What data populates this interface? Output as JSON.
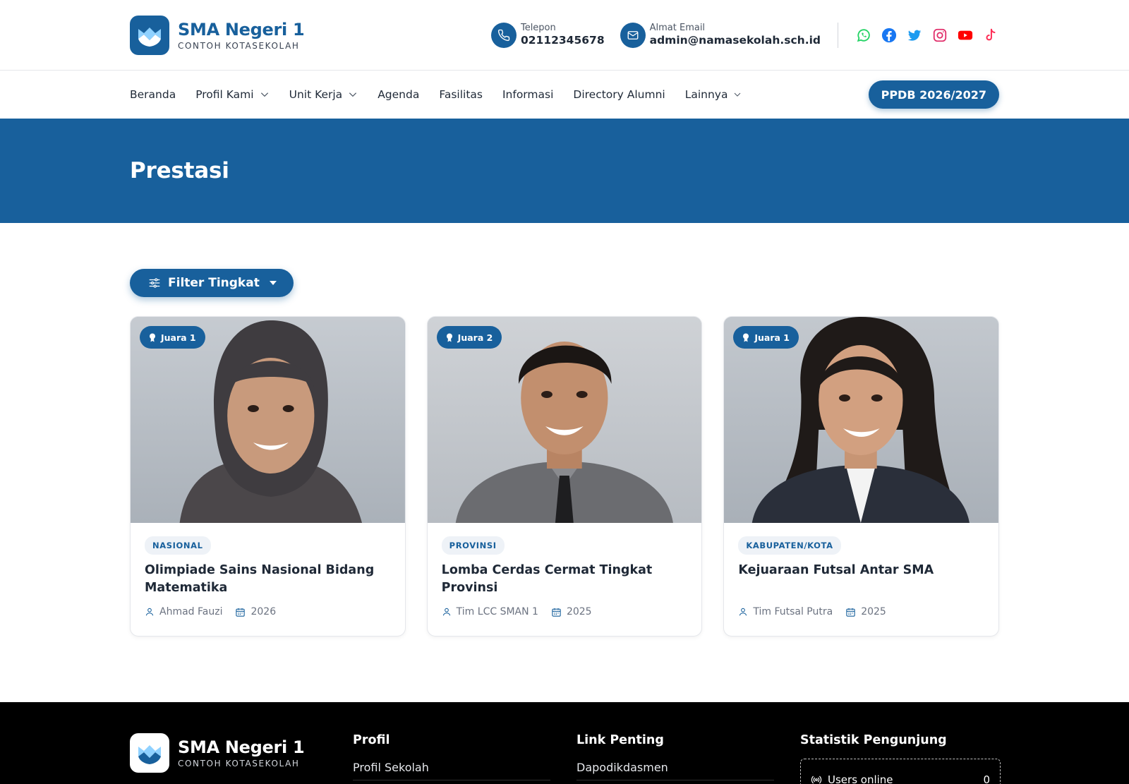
{
  "brand": {
    "name": "SMA Negeri 1",
    "sub": "CONTOH KOTASEKOLAH"
  },
  "contact": {
    "phone_label": "Telepon",
    "phone": "02112345678",
    "email_label": "Almat Email",
    "email": "admin@namasekolah.sch.id"
  },
  "socials": [
    "whatsapp-icon",
    "facebook-icon",
    "twitter-icon",
    "instagram-icon",
    "youtube-icon",
    "tiktok-icon"
  ],
  "nav": {
    "items": [
      "Beranda",
      "Profil Kami",
      "Unit Kerja",
      "Agenda",
      "Fasilitas",
      "Informasi",
      "Directory Alumni",
      "Lainnya"
    ],
    "cta": "PPDB 2026/2027"
  },
  "page_title": "Prestasi",
  "filter_label": "Filter Tingkat",
  "cards": [
    {
      "award": "Juara 1",
      "level": "NASIONAL",
      "title": "Olimpiade Sains Nasional Bidang Matematika",
      "person": "Ahmad Fauzi",
      "year": "2026"
    },
    {
      "award": "Juara 2",
      "level": "PROVINSI",
      "title": "Lomba Cerdas Cermat Tingkat Provinsi",
      "person": "Tim LCC SMAN 1",
      "year": "2025"
    },
    {
      "award": "Juara 1",
      "level": "KABUPATEN/KOTA",
      "title": "Kejuaraan Futsal Antar SMA",
      "person": "Tim Futsal Putra",
      "year": "2025"
    }
  ],
  "footer": {
    "col1_title": "Profil",
    "col1_link": "Profil Sekolah",
    "col2_title": "Link Penting",
    "col2_link": "Dapodikdasmen",
    "col3_title": "Statistik Pengunjung",
    "stat_label": "Users online",
    "stat_value": "0"
  },
  "colors": {
    "primary": "#18609c",
    "footer_bg": "#000000",
    "whatsapp": "#25d366",
    "facebook": "#1877f2",
    "twitter": "#1d9bf0",
    "instagram": "#e1306c",
    "youtube": "#ff0000",
    "tiktok": "#fe2c55"
  }
}
